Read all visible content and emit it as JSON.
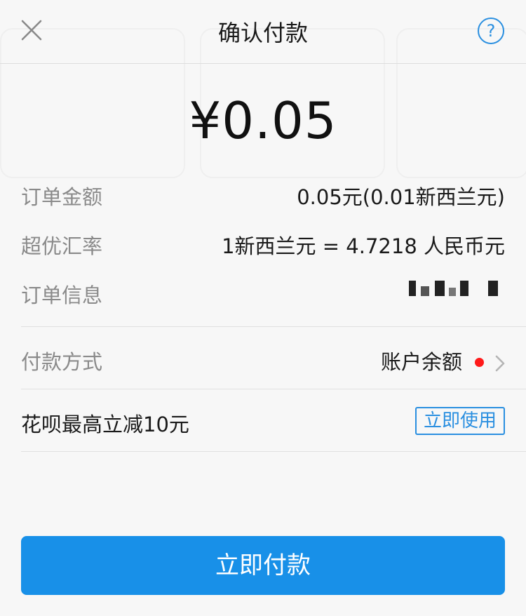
{
  "header": {
    "title": "确认付款",
    "help_label": "?"
  },
  "amount": "¥0.05",
  "details": [
    {
      "label": "订单金额",
      "value": "0.05元(0.01新西兰元)"
    },
    {
      "label": "超优汇率",
      "value": "1新西兰元 = 4.7218 人民币元"
    },
    {
      "label": "订单信息",
      "value": ""
    }
  ],
  "payment": {
    "label": "付款方式",
    "value": "账户余额"
  },
  "promo": {
    "text": "花呗最高立减10元",
    "button": "立即使用"
  },
  "pay_button": "立即付款",
  "colors": {
    "accent": "#1890e8",
    "link": "#2a8fe0",
    "alert_dot": "#ff1a1a"
  }
}
